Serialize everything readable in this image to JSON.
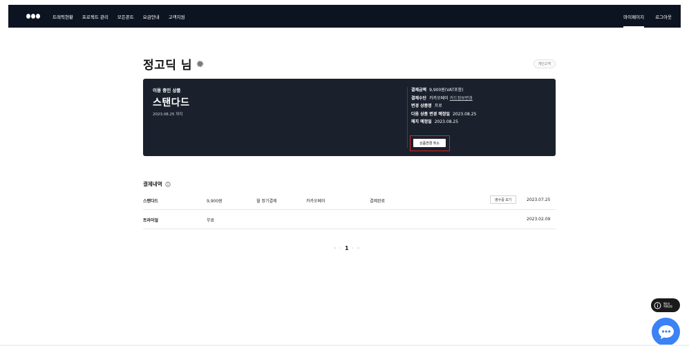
{
  "nav": {
    "items": [
      "트래픽현황",
      "프로젝트 관리",
      "모든폰트",
      "요금안내",
      "고객지원"
    ],
    "right": [
      "마이페이지",
      "로그아웃"
    ]
  },
  "header": {
    "title": "정고딕 님",
    "badge": "개인고객"
  },
  "subscription": {
    "using_label": "이용 중인 상품",
    "plan": "스탠다드",
    "until": "2023.08.25 까지",
    "details": [
      {
        "key": "결제금액",
        "value": "9,900원(VAT포함)"
      },
      {
        "key": "결제수단",
        "value": "카카오페이",
        "link": "카드정보변경"
      },
      {
        "key": "변경 상품명",
        "value": "프로"
      },
      {
        "key": "다음 상품 변경 예정일",
        "value": "2023.08.25"
      },
      {
        "key": "해지 예정일",
        "value": "2023.08.25"
      }
    ],
    "cancel_button": "상품변경 취소"
  },
  "history": {
    "title": "결제내역",
    "rows": [
      {
        "plan": "스탠다드",
        "amount": "9,900원",
        "cycle": "월 정기결제",
        "method": "카카오페이",
        "status": "결제완료",
        "receipt": "영수증 보기",
        "date": "2023.07.25"
      },
      {
        "plan": "트라이얼",
        "amount": "무료",
        "cycle": "",
        "method": "",
        "status": "",
        "receipt": "",
        "date": "2023.02.09"
      }
    ]
  },
  "pagination": {
    "first": "«",
    "prev": "‹",
    "current": "1",
    "next": "›",
    "last": "»"
  },
  "widgets": {
    "help_line1": "웹폰트",
    "help_line2": "적용방법"
  },
  "colors": {
    "nav_bg": "#0d1421",
    "card_bg": "#1a202c",
    "highlight": "#e02020",
    "chat": "#3b82f6"
  }
}
